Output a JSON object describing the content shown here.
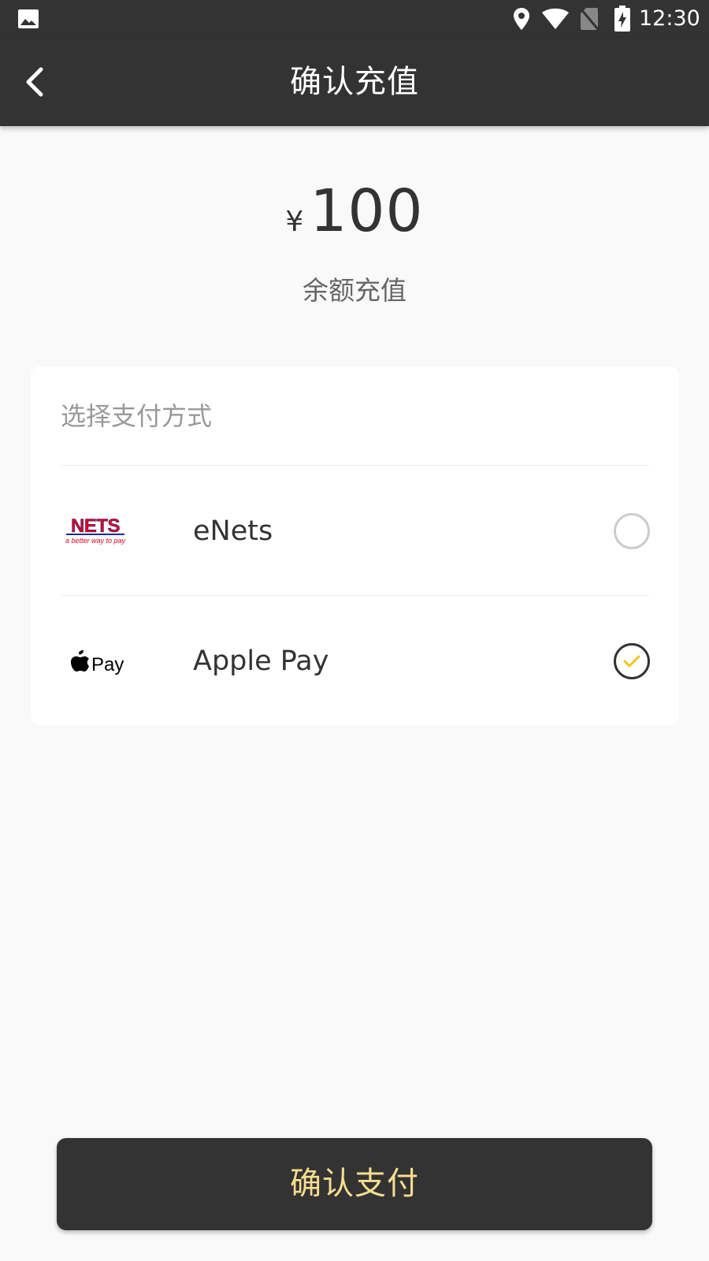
{
  "status_bar": {
    "time": "12:30",
    "icons": [
      "gallery-icon",
      "location-icon",
      "wifi-icon",
      "no-sim-icon",
      "battery-charging-icon"
    ]
  },
  "header": {
    "title": "确认充值",
    "back_icon": "chevron-left-icon"
  },
  "amount": {
    "currency": "¥",
    "value": "100",
    "description": "余额充值"
  },
  "payment": {
    "title": "选择支付方式",
    "options": [
      {
        "label": "eNets",
        "logo_text": "NETS",
        "logo_tagline": "a better way to pay",
        "selected": false
      },
      {
        "label": "Apple Pay",
        "logo_text": "Pay",
        "selected": true
      }
    ]
  },
  "confirm_button": {
    "label": "确认支付"
  },
  "colors": {
    "bar_background": "#333333",
    "page_background": "#f9f9f9",
    "accent": "#f6dd8e",
    "check_accent": "#f5c518",
    "nets_red": "#e3001b",
    "nets_blue": "#1a2d8c"
  }
}
